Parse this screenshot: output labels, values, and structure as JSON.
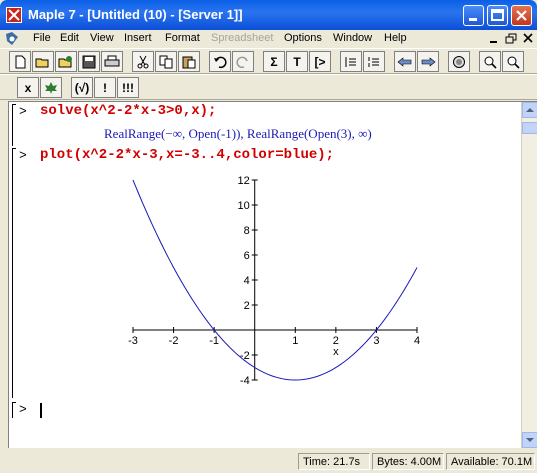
{
  "window": {
    "title": "Maple 7  - [Untitled (10) - [Server 1]]",
    "accent": "#0a5fe6",
    "close_color": "#c2361c"
  },
  "menu": {
    "items": [
      "File",
      "Edit",
      "View",
      "Insert",
      "Format",
      "Spreadsheet",
      "Options",
      "Window",
      "Help"
    ],
    "disabled": [
      "Spreadsheet"
    ]
  },
  "toolbar1": {
    "icons": [
      "new-icon",
      "open-icon",
      "open-url-icon",
      "save-icon",
      "print-icon",
      "cut-icon",
      "copy-icon",
      "paste-icon",
      "undo-icon",
      "redo-icon",
      "sigma-icon",
      "text-icon",
      "insert-prompt-icon",
      "group-icon",
      "ungroup-icon",
      "back-icon",
      "forward-icon",
      "stop-icon",
      "zoom-in-icon",
      "zoom-out-icon"
    ],
    "sigma_label": "Σ",
    "text_label": "T",
    "prompt_label": "[>"
  },
  "toolbar2": {
    "x_label": "x",
    "check_label": "(√)",
    "exclaim_label": "!",
    "exclaim3_label": "!!!"
  },
  "worksheet": {
    "prompt": ">",
    "cmd1": "solve(x^2-2*x-3>0,x);",
    "output1": "RealRange(−∞, Open(-1)), RealRange(Open(3), ∞)",
    "cmd2": "plot(x^2-2*x-3,x=-3..4,color=blue);",
    "curve_color": "#1a1ab4",
    "command_color": "#d00000"
  },
  "chart_data": {
    "type": "line",
    "function": "x^2-2*x-3",
    "x": [
      -3,
      -2.5,
      -2,
      -1.5,
      -1,
      -0.5,
      0,
      0.5,
      1,
      1.5,
      2,
      2.5,
      3,
      3.5,
      4
    ],
    "y": [
      12,
      8.25,
      5,
      2.25,
      0,
      -1.75,
      -3,
      -3.75,
      -4,
      -3.75,
      -3,
      -1.75,
      0,
      2.25,
      5
    ],
    "xlabel": "x",
    "ylabel": "",
    "xlim": [
      -3,
      4
    ],
    "ylim": [
      -4,
      12
    ],
    "x_ticks": [
      "-3",
      "-2",
      "-1",
      "1",
      "2",
      "3",
      "4"
    ],
    "y_ticks": [
      "-4",
      "-2",
      "2",
      "4",
      "6",
      "8",
      "10",
      "12"
    ],
    "grid": false
  },
  "status": {
    "time": "Time:  21.7s",
    "bytes": "Bytes: 4.00M",
    "available": "Available: 70.1M"
  }
}
